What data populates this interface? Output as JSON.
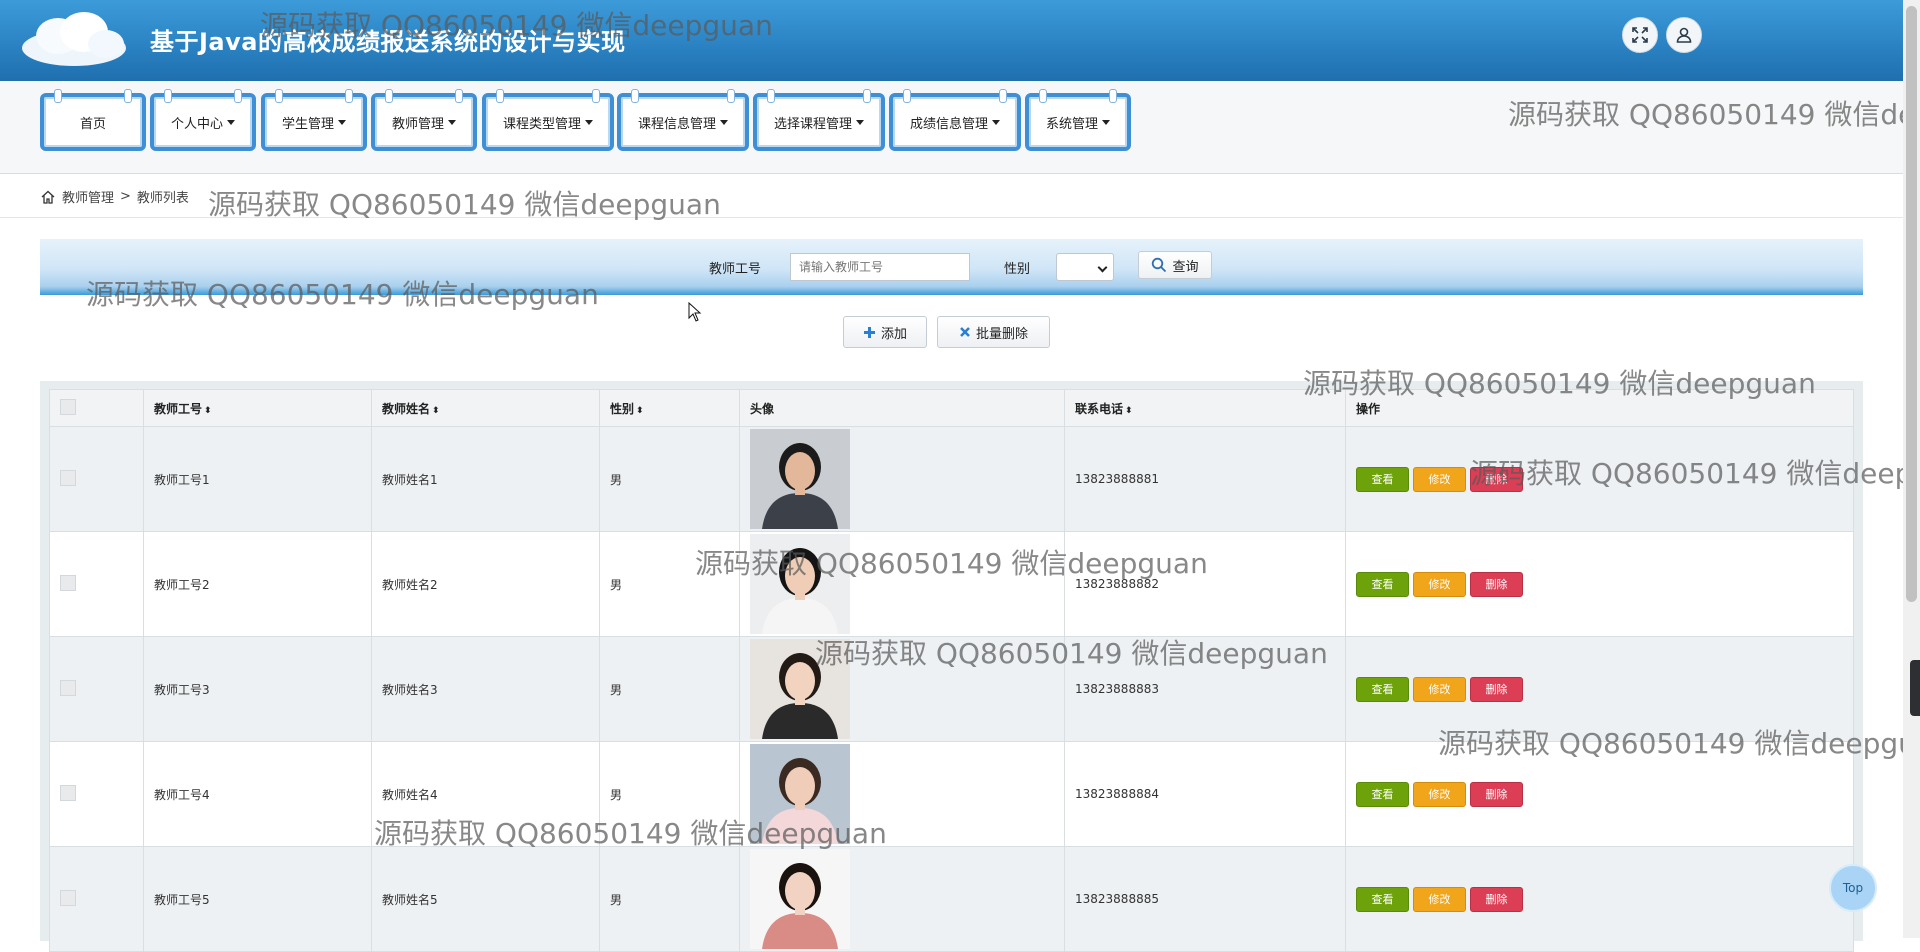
{
  "app": {
    "title": "基于Java的高校成绩报送系统的设计与实现"
  },
  "header": {
    "fullscreen_icon": "fullscreen-icon",
    "user_icon": "user-icon"
  },
  "nav": {
    "items": [
      {
        "label": "首页",
        "dropdown": false
      },
      {
        "label": "个人中心",
        "dropdown": true
      },
      {
        "label": "学生管理",
        "dropdown": true
      },
      {
        "label": "教师管理",
        "dropdown": true
      },
      {
        "label": "课程类型管理",
        "dropdown": true
      },
      {
        "label": "课程信息管理",
        "dropdown": true
      },
      {
        "label": "选择课程管理",
        "dropdown": true
      },
      {
        "label": "成绩信息管理",
        "dropdown": true
      },
      {
        "label": "系统管理",
        "dropdown": true
      }
    ]
  },
  "breadcrumb": {
    "level1": "教师管理",
    "separator": ">",
    "level2": "教师列表"
  },
  "search": {
    "teacher_no_label": "教师工号",
    "teacher_no_placeholder": "请输入教师工号",
    "gender_label": "性别",
    "gender_value": "",
    "query_label": "查询"
  },
  "toolbar": {
    "add_label": "添加",
    "batch_delete_label": "批量删除"
  },
  "table": {
    "columns": [
      "教师工号",
      "教师姓名",
      "性别",
      "头像",
      "联系电话",
      "操作"
    ],
    "rows": [
      {
        "no": "教师工号1",
        "name": "教师姓名1",
        "gender": "男",
        "phone": "13823888881"
      },
      {
        "no": "教师工号2",
        "name": "教师姓名2",
        "gender": "男",
        "phone": "13823888882"
      },
      {
        "no": "教师工号3",
        "name": "教师姓名3",
        "gender": "男",
        "phone": "13823888883"
      },
      {
        "no": "教师工号4",
        "name": "教师姓名4",
        "gender": "男",
        "phone": "13823888884"
      },
      {
        "no": "教师工号5",
        "name": "教师姓名5",
        "gender": "男",
        "phone": "13823888885"
      }
    ],
    "actions": {
      "view": "查看",
      "edit": "修改",
      "delete": "删除"
    }
  },
  "watermark": {
    "text": "源码获取 QQ86050149 微信deepguan"
  },
  "top_button": {
    "label": "Top"
  },
  "colors": {
    "header": "#2b83c3",
    "nav_border": "#3e8fd6",
    "view": "#6ea20b",
    "edit": "#f0a51b",
    "delete": "#dc3e55"
  }
}
